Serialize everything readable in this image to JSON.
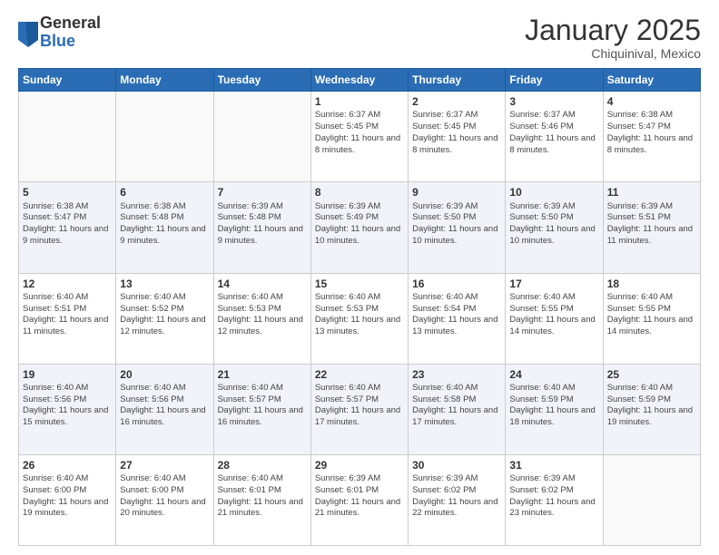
{
  "logo": {
    "general": "General",
    "blue": "Blue"
  },
  "title": "January 2025",
  "subtitle": "Chiquinival, Mexico",
  "days_of_week": [
    "Sunday",
    "Monday",
    "Tuesday",
    "Wednesday",
    "Thursday",
    "Friday",
    "Saturday"
  ],
  "weeks": [
    [
      {
        "day": "",
        "info": ""
      },
      {
        "day": "",
        "info": ""
      },
      {
        "day": "",
        "info": ""
      },
      {
        "day": "1",
        "info": "Sunrise: 6:37 AM\nSunset: 5:45 PM\nDaylight: 11 hours and 8 minutes."
      },
      {
        "day": "2",
        "info": "Sunrise: 6:37 AM\nSunset: 5:45 PM\nDaylight: 11 hours and 8 minutes."
      },
      {
        "day": "3",
        "info": "Sunrise: 6:37 AM\nSunset: 5:46 PM\nDaylight: 11 hours and 8 minutes."
      },
      {
        "day": "4",
        "info": "Sunrise: 6:38 AM\nSunset: 5:47 PM\nDaylight: 11 hours and 8 minutes."
      }
    ],
    [
      {
        "day": "5",
        "info": "Sunrise: 6:38 AM\nSunset: 5:47 PM\nDaylight: 11 hours and 9 minutes."
      },
      {
        "day": "6",
        "info": "Sunrise: 6:38 AM\nSunset: 5:48 PM\nDaylight: 11 hours and 9 minutes."
      },
      {
        "day": "7",
        "info": "Sunrise: 6:39 AM\nSunset: 5:48 PM\nDaylight: 11 hours and 9 minutes."
      },
      {
        "day": "8",
        "info": "Sunrise: 6:39 AM\nSunset: 5:49 PM\nDaylight: 11 hours and 10 minutes."
      },
      {
        "day": "9",
        "info": "Sunrise: 6:39 AM\nSunset: 5:50 PM\nDaylight: 11 hours and 10 minutes."
      },
      {
        "day": "10",
        "info": "Sunrise: 6:39 AM\nSunset: 5:50 PM\nDaylight: 11 hours and 10 minutes."
      },
      {
        "day": "11",
        "info": "Sunrise: 6:39 AM\nSunset: 5:51 PM\nDaylight: 11 hours and 11 minutes."
      }
    ],
    [
      {
        "day": "12",
        "info": "Sunrise: 6:40 AM\nSunset: 5:51 PM\nDaylight: 11 hours and 11 minutes."
      },
      {
        "day": "13",
        "info": "Sunrise: 6:40 AM\nSunset: 5:52 PM\nDaylight: 11 hours and 12 minutes."
      },
      {
        "day": "14",
        "info": "Sunrise: 6:40 AM\nSunset: 5:53 PM\nDaylight: 11 hours and 12 minutes."
      },
      {
        "day": "15",
        "info": "Sunrise: 6:40 AM\nSunset: 5:53 PM\nDaylight: 11 hours and 13 minutes."
      },
      {
        "day": "16",
        "info": "Sunrise: 6:40 AM\nSunset: 5:54 PM\nDaylight: 11 hours and 13 minutes."
      },
      {
        "day": "17",
        "info": "Sunrise: 6:40 AM\nSunset: 5:55 PM\nDaylight: 11 hours and 14 minutes."
      },
      {
        "day": "18",
        "info": "Sunrise: 6:40 AM\nSunset: 5:55 PM\nDaylight: 11 hours and 14 minutes."
      }
    ],
    [
      {
        "day": "19",
        "info": "Sunrise: 6:40 AM\nSunset: 5:56 PM\nDaylight: 11 hours and 15 minutes."
      },
      {
        "day": "20",
        "info": "Sunrise: 6:40 AM\nSunset: 5:56 PM\nDaylight: 11 hours and 16 minutes."
      },
      {
        "day": "21",
        "info": "Sunrise: 6:40 AM\nSunset: 5:57 PM\nDaylight: 11 hours and 16 minutes."
      },
      {
        "day": "22",
        "info": "Sunrise: 6:40 AM\nSunset: 5:57 PM\nDaylight: 11 hours and 17 minutes."
      },
      {
        "day": "23",
        "info": "Sunrise: 6:40 AM\nSunset: 5:58 PM\nDaylight: 11 hours and 17 minutes."
      },
      {
        "day": "24",
        "info": "Sunrise: 6:40 AM\nSunset: 5:59 PM\nDaylight: 11 hours and 18 minutes."
      },
      {
        "day": "25",
        "info": "Sunrise: 6:40 AM\nSunset: 5:59 PM\nDaylight: 11 hours and 19 minutes."
      }
    ],
    [
      {
        "day": "26",
        "info": "Sunrise: 6:40 AM\nSunset: 6:00 PM\nDaylight: 11 hours and 19 minutes."
      },
      {
        "day": "27",
        "info": "Sunrise: 6:40 AM\nSunset: 6:00 PM\nDaylight: 11 hours and 20 minutes."
      },
      {
        "day": "28",
        "info": "Sunrise: 6:40 AM\nSunset: 6:01 PM\nDaylight: 11 hours and 21 minutes."
      },
      {
        "day": "29",
        "info": "Sunrise: 6:39 AM\nSunset: 6:01 PM\nDaylight: 11 hours and 21 minutes."
      },
      {
        "day": "30",
        "info": "Sunrise: 6:39 AM\nSunset: 6:02 PM\nDaylight: 11 hours and 22 minutes."
      },
      {
        "day": "31",
        "info": "Sunrise: 6:39 AM\nSunset: 6:02 PM\nDaylight: 11 hours and 23 minutes."
      },
      {
        "day": "",
        "info": ""
      }
    ]
  ]
}
